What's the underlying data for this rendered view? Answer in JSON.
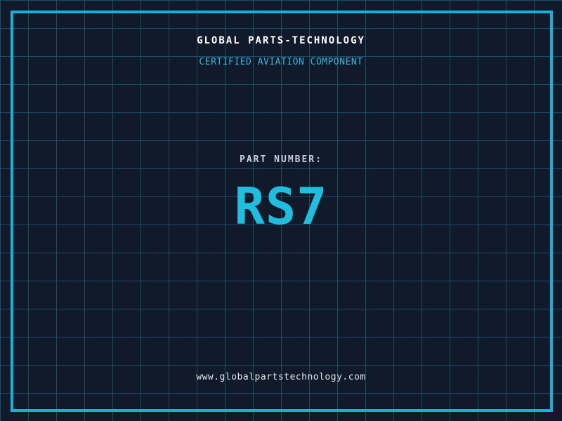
{
  "certificate": {
    "company": "GLOBAL PARTS-TECHNOLOGY",
    "subtitle": "CERTIFIED AVIATION COMPONENT",
    "part_label": "PART NUMBER:",
    "part_number": "RS7",
    "website": "www.globalpartstechnology.com"
  },
  "colors": {
    "background": "#101a2b",
    "grid-line": "#1c4d66",
    "frame": "#0db5dc",
    "title": "#ffffff",
    "subtitle": "#38b6d9",
    "label": "#c9cfd8",
    "part-number": "#1fbede",
    "website": "#e2e6ea"
  }
}
